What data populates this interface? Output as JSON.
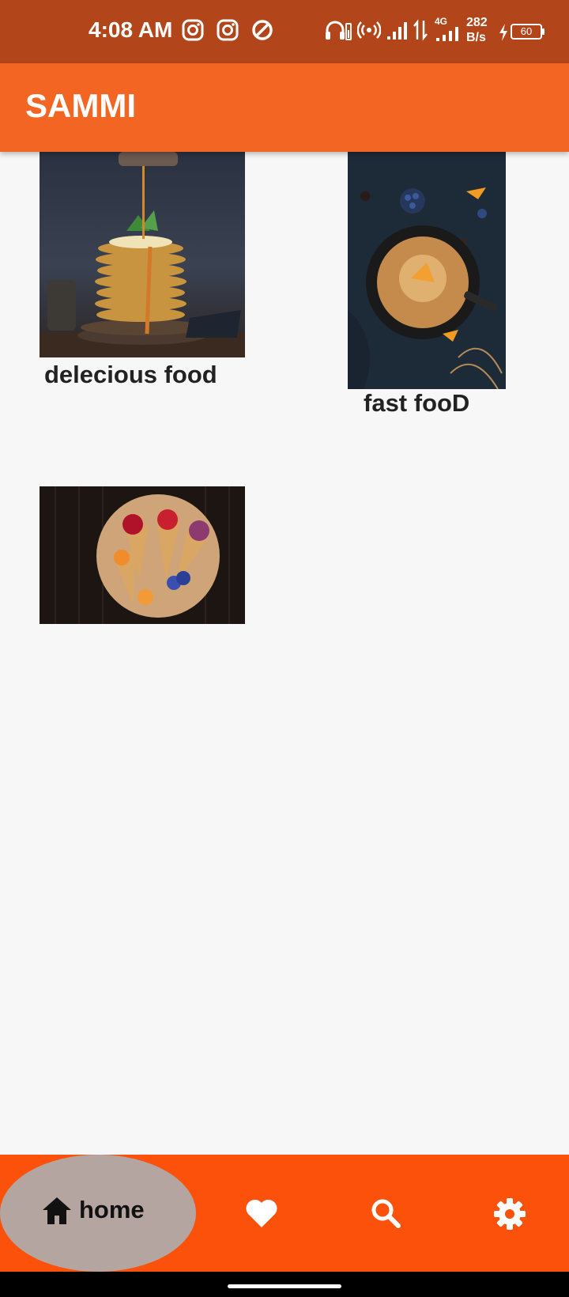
{
  "status_bar": {
    "time": "4:08 AM",
    "net_type": "4G",
    "speed_value": "282",
    "speed_unit": "B/s",
    "battery_level": "60",
    "icons": [
      "instagram-icon",
      "instagram-icon",
      "app-icon",
      "headphones-icon",
      "hotspot-icon",
      "signal-icon",
      "data-arrows-icon",
      "signal-icon",
      "charging-icon",
      "battery-icon"
    ]
  },
  "app_bar": {
    "title": "SAMMI"
  },
  "grid": {
    "items": [
      {
        "label": "delecious food",
        "image": "pancake-stack-photo"
      },
      {
        "label": "fast fooD",
        "image": "skillet-dish-photo"
      },
      {
        "label": "",
        "image": "fruit-cones-photo"
      }
    ]
  },
  "bottom_nav": {
    "items": [
      {
        "label": "home",
        "icon": "home-icon",
        "selected": true
      },
      {
        "label": "",
        "icon": "heart-icon",
        "selected": false
      },
      {
        "label": "",
        "icon": "search-icon",
        "selected": false
      },
      {
        "label": "",
        "icon": "gear-icon",
        "selected": false
      }
    ]
  },
  "colors": {
    "status_bar": "#b2461a",
    "app_bar": "#f26522",
    "bottom_nav": "#fb510b",
    "selected_pill": "#b5a5a0",
    "background": "#f7f7f7"
  }
}
